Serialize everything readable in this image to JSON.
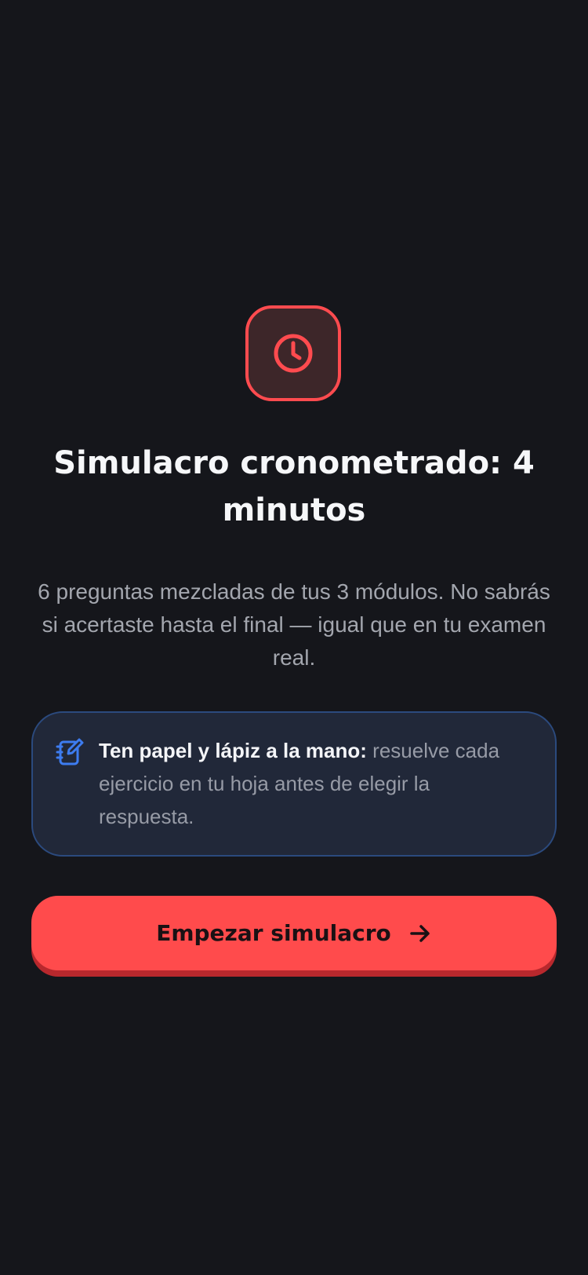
{
  "intro": {
    "icon": "clock-icon",
    "title": "Simulacro cronometrado: 4 minutos",
    "description": "6 preguntas mezcladas de tus 3 módulos. No sabrás si acertaste hasta el final — igual que en tu examen real."
  },
  "tip": {
    "icon": "notebook-pencil-icon",
    "strong": "Ten papel y lápiz a la mano:",
    "text": " resuelve cada ejercicio en tu hoja antes de elegir la respuesta."
  },
  "start_button": {
    "label": "Empezar simulacro",
    "icon": "arrow-right-icon"
  },
  "colors": {
    "background": "#15161b",
    "accent": "#ff4b4c",
    "info": "#3d7cf0"
  }
}
